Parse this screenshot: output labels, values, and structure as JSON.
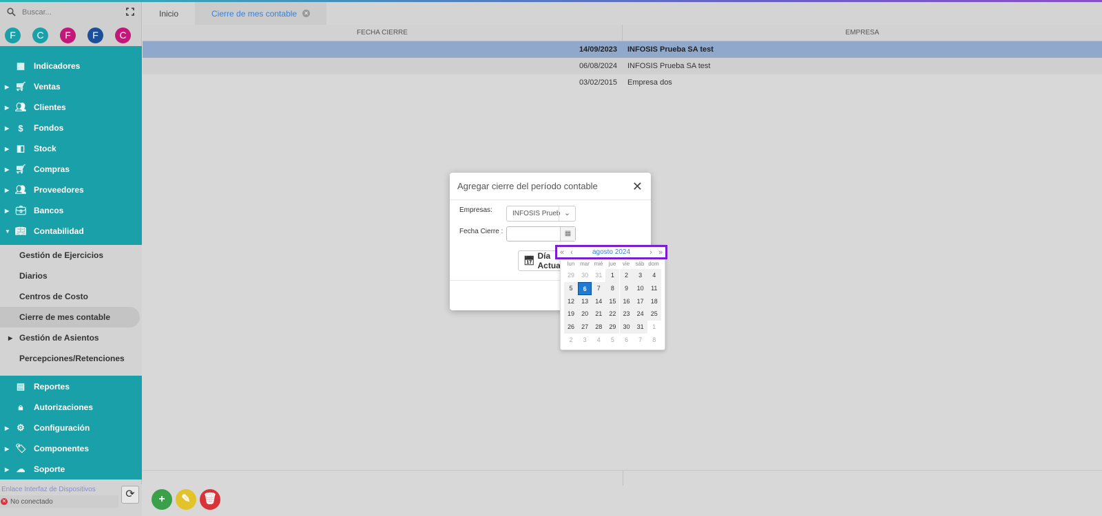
{
  "sidebar": {
    "search_placeholder": "Buscar...",
    "avatars": [
      {
        "letter": "F",
        "color": "#1aa0a8"
      },
      {
        "letter": "C",
        "color": "#1aa0a8"
      },
      {
        "letter": "F",
        "color": "#c2187a"
      },
      {
        "letter": "F",
        "color": "#1b4f9a"
      },
      {
        "letter": "C",
        "color": "#c2187a"
      }
    ],
    "menu": [
      {
        "label": "Indicadores",
        "icon": "dashboard-icon"
      },
      {
        "label": "Ventas",
        "icon": "cart-icon"
      },
      {
        "label": "Clientes",
        "icon": "people-icon"
      },
      {
        "label": "Fondos",
        "icon": "dollar-icon"
      },
      {
        "label": "Stock",
        "icon": "stock-icon"
      },
      {
        "label": "Compras",
        "icon": "cart-add-icon"
      },
      {
        "label": "Proveedores",
        "icon": "people-icon"
      },
      {
        "label": "Bancos",
        "icon": "briefcase-icon"
      },
      {
        "label": "Contabilidad",
        "icon": "book-icon"
      }
    ],
    "submenu": [
      {
        "label": "Gestión de Ejercicios"
      },
      {
        "label": "Diarios"
      },
      {
        "label": "Centros de Costo"
      },
      {
        "label": "Cierre de mes contable"
      },
      {
        "label": "Gestión de Asientos"
      },
      {
        "label": "Percepciones/Retenciones"
      }
    ],
    "menu_bottom": [
      {
        "label": "Reportes",
        "icon": "report-icon"
      },
      {
        "label": "Autorizaciones",
        "icon": "lock-icon"
      },
      {
        "label": "Configuración",
        "icon": "gears-icon"
      },
      {
        "label": "Componentes",
        "icon": "tag-icon"
      },
      {
        "label": "Soporte",
        "icon": "cloud-icon"
      }
    ],
    "device_link": "Enlace Interfaz de Dispositivos",
    "device_status": "No conectado"
  },
  "tabs": [
    {
      "label": "Inicio"
    },
    {
      "label": "Cierre de mes contable"
    }
  ],
  "grid": {
    "headers": [
      "FECHA CIERRE",
      "EMPRESA"
    ],
    "rows": [
      {
        "fecha": "14/09/2023",
        "empresa": "INFOSIS Prueba SA test"
      },
      {
        "fecha": "06/08/2024",
        "empresa": "INFOSIS Prueba SA test"
      },
      {
        "fecha": "03/02/2015",
        "empresa": "Empresa dos"
      }
    ]
  },
  "modal": {
    "title": "Agregar cierre del período contable",
    "empresas_label": "Empresas:",
    "empresas_value": "INFOSIS Prueba SA test",
    "fecha_label": "Fecha Cierre :",
    "today_button": "Día Actual"
  },
  "calendar": {
    "month_label": "agosto 2024",
    "weekdays": [
      "lun",
      "mar",
      "mié",
      "jue",
      "vie",
      "sáb",
      "dom"
    ],
    "days": [
      {
        "d": "29",
        "out": true
      },
      {
        "d": "30",
        "out": true
      },
      {
        "d": "31",
        "out": true
      },
      {
        "d": "1"
      },
      {
        "d": "2"
      },
      {
        "d": "3"
      },
      {
        "d": "4"
      },
      {
        "d": "5"
      },
      {
        "d": "6",
        "today": true
      },
      {
        "d": "7"
      },
      {
        "d": "8"
      },
      {
        "d": "9"
      },
      {
        "d": "10"
      },
      {
        "d": "11"
      },
      {
        "d": "12"
      },
      {
        "d": "13"
      },
      {
        "d": "14"
      },
      {
        "d": "15"
      },
      {
        "d": "16"
      },
      {
        "d": "17"
      },
      {
        "d": "18"
      },
      {
        "d": "19"
      },
      {
        "d": "20"
      },
      {
        "d": "21"
      },
      {
        "d": "22"
      },
      {
        "d": "23"
      },
      {
        "d": "24"
      },
      {
        "d": "25"
      },
      {
        "d": "26"
      },
      {
        "d": "27"
      },
      {
        "d": "28"
      },
      {
        "d": "29"
      },
      {
        "d": "30"
      },
      {
        "d": "31"
      },
      {
        "d": "1",
        "out": true
      },
      {
        "d": "2",
        "out": true
      },
      {
        "d": "3",
        "out": true
      },
      {
        "d": "4",
        "out": true
      },
      {
        "d": "5",
        "out": true
      },
      {
        "d": "6",
        "out": true
      },
      {
        "d": "7",
        "out": true
      },
      {
        "d": "8",
        "out": true
      }
    ]
  },
  "colors": {
    "accent": "#1aa0a8",
    "selected_row": "#8fa8cc",
    "add": "#3aa04a",
    "edit": "#e3c32a",
    "delete": "#d9333a",
    "highlight_border": "#7a1fd0"
  }
}
